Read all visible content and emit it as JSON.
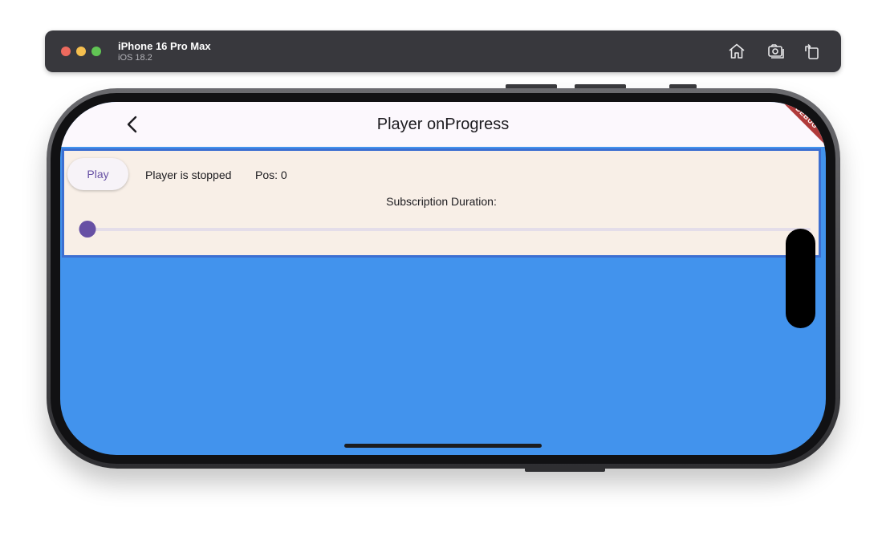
{
  "simulator": {
    "device_name": "iPhone 16 Pro Max",
    "os_version": "iOS 18.2",
    "toolbar_icons": [
      "home-icon",
      "screenshot-icon",
      "rotate-icon"
    ]
  },
  "appbar": {
    "title": "Player onProgress",
    "back_icon": "chevron-left-icon",
    "debug_banner": "DEBUG"
  },
  "player": {
    "play_label": "Play",
    "status": "Player is stopped",
    "position": "Pos: 0",
    "subscription_label": "Subscription Duration:",
    "slider_value": 0
  },
  "colors": {
    "background": "#4293ed",
    "panel": "#f8efe7",
    "panel_border": "#3d6fd1",
    "accent": "#6750a4",
    "debug_banner": "#b03a3a"
  }
}
